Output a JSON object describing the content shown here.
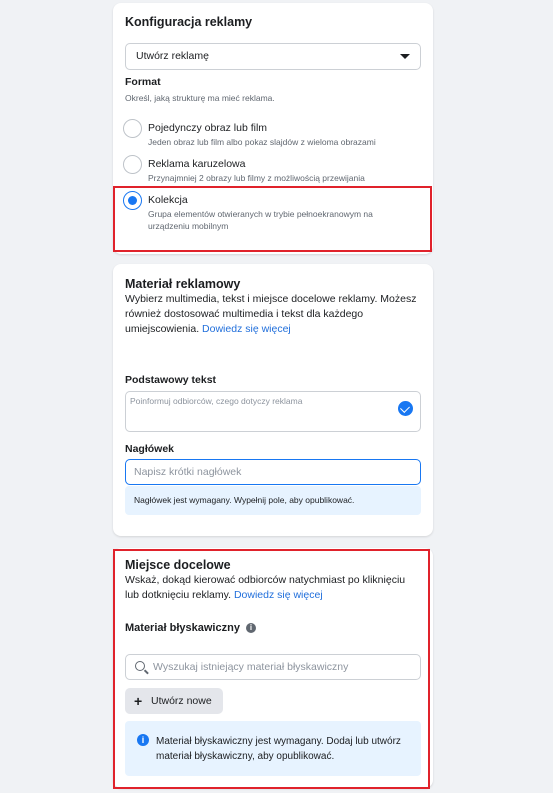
{
  "ad_config": {
    "title": "Konfiguracja reklamy",
    "select_value": "Utwórz reklamę",
    "format_label": "Format",
    "format_desc": "Określ, jaką strukturę ma mieć reklama.",
    "options": [
      {
        "title": "Pojedynczy obraz lub film",
        "desc": "Jeden obraz lub film albo pokaz slajdów z wieloma obrazami",
        "selected": false
      },
      {
        "title": "Reklama karuzelowa",
        "desc": "Przynajmniej 2 obrazy lub filmy z możliwością przewijania",
        "selected": false
      },
      {
        "title": "Kolekcja",
        "desc": "Grupa elementów otwieranych w trybie pełnoekranowym na urządzeniu mobilnym",
        "selected": true
      }
    ]
  },
  "creative": {
    "title": "Materiał reklamowy",
    "desc": "Wybierz multimedia, tekst i miejsce docelowe reklamy. Możesz również dostosować multimedia i tekst dla każdego umiejscowienia.",
    "learn_more": "Dowiedz się więcej",
    "primary_text_label": "Podstawowy tekst",
    "primary_text_placeholder": "Poinformuj odbiorców, czego dotyczy reklama",
    "headline_label": "Nagłówek",
    "headline_placeholder": "Napisz krótki nagłówek",
    "headline_note": "Nagłówek jest wymagany. Wypełnij pole, aby opublikować."
  },
  "destination": {
    "title": "Miejsce docelowe",
    "desc": "Wskaż, dokąd kierować odbiorców natychmiast po kliknięciu lub dotknięciu reklamy.",
    "learn_more": "Dowiedz się więcej",
    "instant_label": "Materiał błyskawiczny",
    "search_placeholder": "Wyszukaj istniejący materiał błyskawiczny",
    "create_label": "Utwórz nowe",
    "info": "Materiał błyskawiczny jest wymagany. Dodaj lub utwórz materiał błyskawiczny, aby opublikować."
  },
  "colors": {
    "accent": "#1877f2",
    "highlight_border": "#e0222b",
    "note_bg": "#e7f3ff"
  }
}
